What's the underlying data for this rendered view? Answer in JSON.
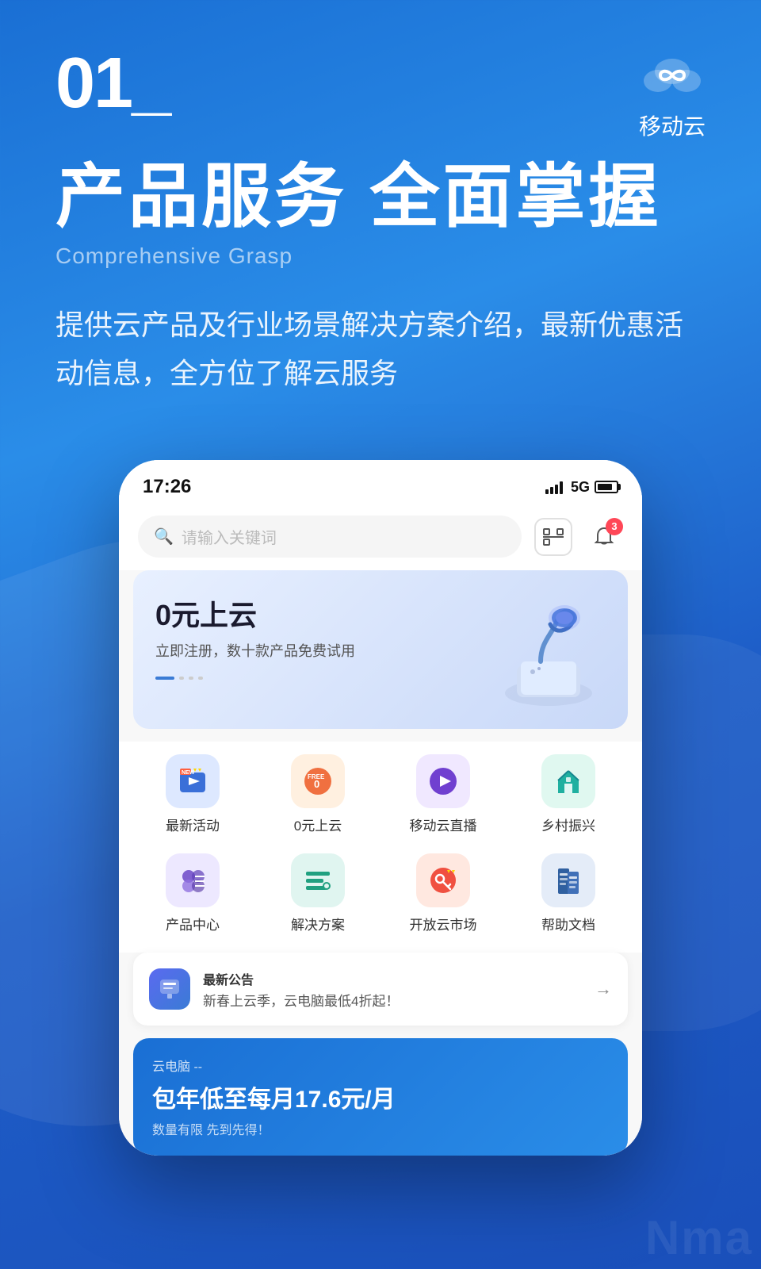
{
  "background": {
    "gradient_start": "#1a6fd4",
    "gradient_end": "#1a4fba"
  },
  "header": {
    "section_number": "01_",
    "logo_name": "移动云",
    "logo_icon": "cloud"
  },
  "hero": {
    "main_title": "产品服务 全面掌握",
    "subtitle_en": "Comprehensive Grasp",
    "description": "提供云产品及行业场景解决方案介绍，最新优惠活\n动信息，全方位了解云服务"
  },
  "phone": {
    "status_bar": {
      "time": "17:26",
      "network": "5G",
      "signal_level": 4,
      "battery_percent": 80
    },
    "search": {
      "placeholder": "请输入关键词",
      "notification_count": "3"
    },
    "banner": {
      "title": "0元上云",
      "subtitle": "立即注册，数十款产品免费试用",
      "dot_count": 4,
      "active_dot": 0
    },
    "icon_grid": [
      {
        "label": "最新活动",
        "color": "#3a7bd5",
        "bg": "#e8f0ff",
        "badge": "NEW"
      },
      {
        "label": "0元上云",
        "color": "#f07040",
        "bg": "#fff0e8",
        "badge": "FREE"
      },
      {
        "label": "移动云直播",
        "color": "#7040d0",
        "bg": "#f0e8ff",
        "badge": ""
      },
      {
        "label": "乡村振兴",
        "color": "#20b0a0",
        "bg": "#e0f8f4",
        "badge": ""
      },
      {
        "label": "产品中心",
        "color": "#6040c0",
        "bg": "#ede8ff",
        "badge": ""
      },
      {
        "label": "解决方案",
        "color": "#20a080",
        "bg": "#e0f5f0",
        "badge": ""
      },
      {
        "label": "开放云市场",
        "color": "#f05040",
        "bg": "#ffe8e0",
        "badge": ""
      },
      {
        "label": "帮助文档",
        "color": "#3060a0",
        "bg": "#e4ecf8",
        "badge": ""
      }
    ],
    "announcement": {
      "tag": "最新\n公告",
      "text": "新春上云季，云电脑最低4折起！",
      "arrow": "→"
    },
    "bottom_card": {
      "tag": "云电脑 --",
      "title": "包年低至每月17.6元/月",
      "subtitle": "数量有限 先到先得！"
    }
  }
}
